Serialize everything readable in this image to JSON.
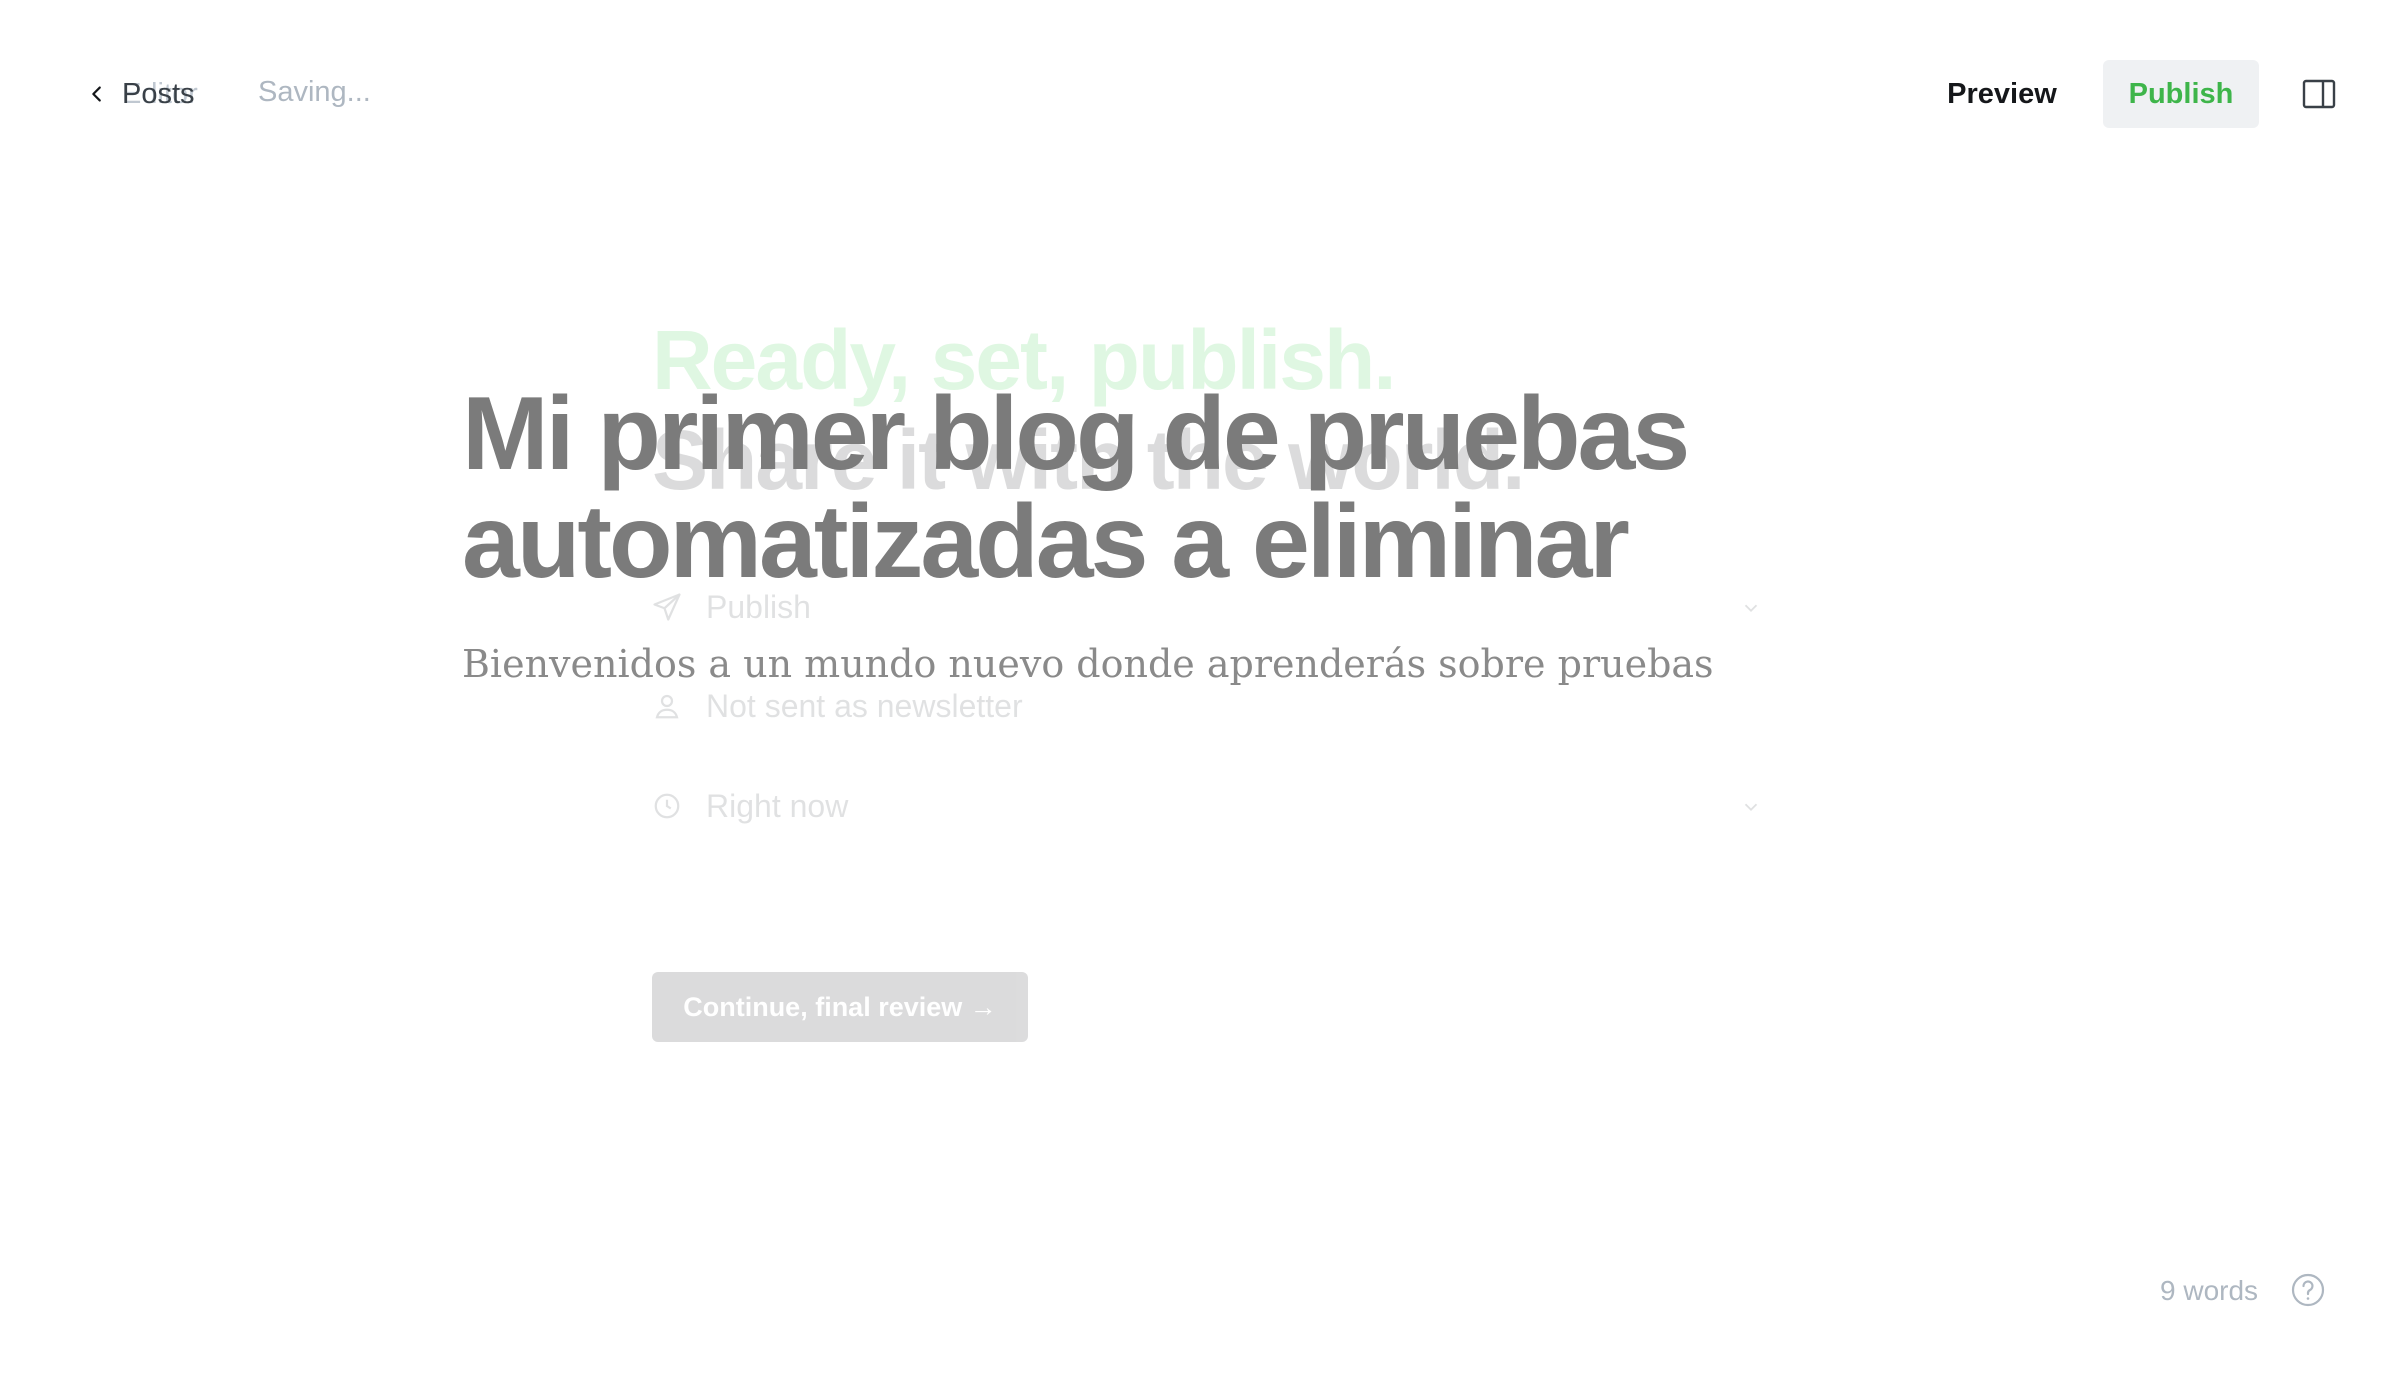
{
  "header": {
    "back_label": "Posts",
    "back_ghost_label": "Editor",
    "status": "Saving...",
    "preview_label": "Preview",
    "publish_label": "Publish"
  },
  "publish_flow": {
    "title_line1": "Ready, set, publish.",
    "title_line2": "Share it with the world.",
    "rows": [
      {
        "icon": "send-icon",
        "label": "Publish"
      },
      {
        "icon": "user-icon",
        "label": "Not sent as newsletter"
      },
      {
        "icon": "clock-icon",
        "label": "Right now"
      }
    ],
    "continue_label": "Continue, final review →"
  },
  "editor": {
    "title": "Mi primer blog de pruebas automatizadas a eliminar",
    "excerpt": "Bienvenidos a un mundo nuevo donde aprenderás sobre pruebas"
  },
  "footer": {
    "word_count": "9 words",
    "help_icon": "help-icon"
  },
  "colors": {
    "accent_green": "#30cf43",
    "publish_bg": "#eff1f3",
    "title_text": "#7b7b7b"
  }
}
